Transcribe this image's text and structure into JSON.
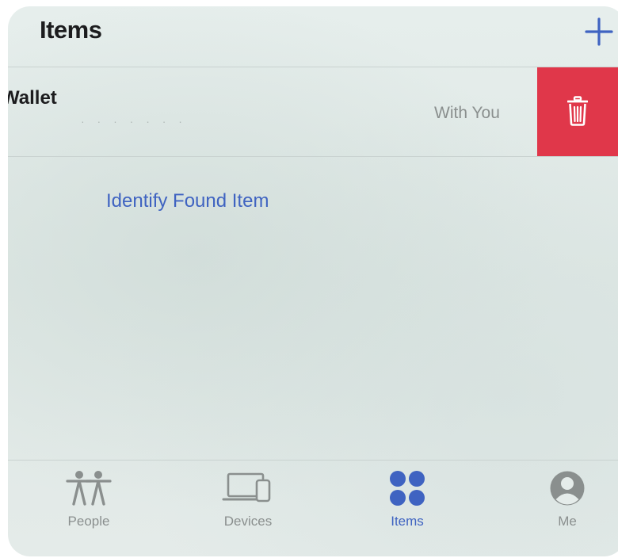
{
  "header": {
    "title": "Items",
    "add_icon": "plus-icon"
  },
  "item_row": {
    "name": "Wallet",
    "subtitle": "· · · · · · ·",
    "status": "With You",
    "delete_icon": "trash-icon",
    "delete_color": "#e0374a"
  },
  "identify_link": "Identify Found Item",
  "tabbar": {
    "tabs": [
      {
        "label": "People",
        "icon": "people-icon",
        "active": false
      },
      {
        "label": "Devices",
        "icon": "devices-icon",
        "active": false
      },
      {
        "label": "Items",
        "icon": "items-icon",
        "active": true
      },
      {
        "label": "Me",
        "icon": "person-circle-icon",
        "active": false
      }
    ]
  },
  "colors": {
    "accent": "#3f63c1",
    "inactive": "#8a8f8e",
    "delete": "#e0374a"
  }
}
